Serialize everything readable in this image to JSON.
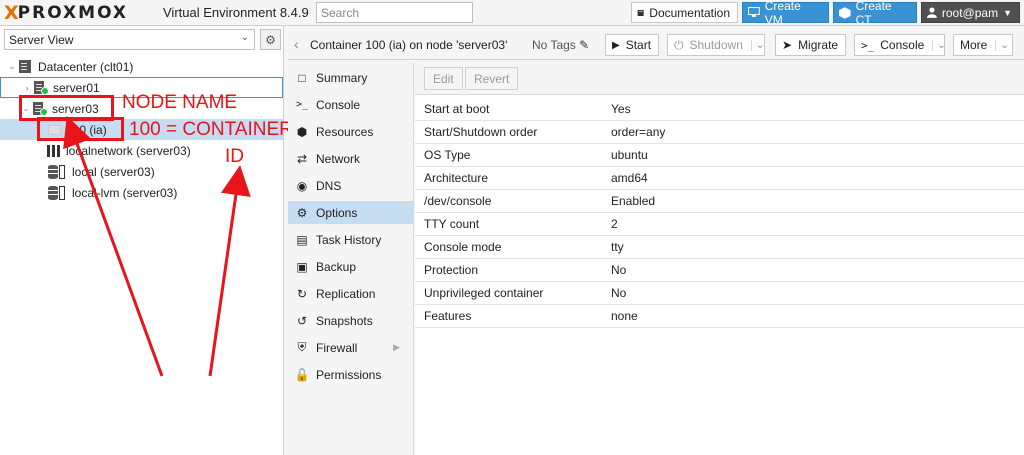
{
  "topbar": {
    "logo_x": "X",
    "logo_brand": "PROXMOX",
    "title": "Virtual Environment 8.4.9",
    "search_placeholder": "Search",
    "documentation": "Documentation",
    "create_vm": "Create VM",
    "create_ct": "Create CT",
    "user": "root@pam"
  },
  "tree": {
    "view": "Server View",
    "items": [
      {
        "label": "Datacenter (clt01)"
      },
      {
        "label": "server01"
      },
      {
        "label": "server03"
      },
      {
        "label": "100 (ia)"
      },
      {
        "label": "localnetwork (server03)"
      },
      {
        "label": "local (server03)"
      },
      {
        "label": "local-lvm (server03)"
      }
    ]
  },
  "annotations": {
    "node_name": "NODE NAME",
    "container_line1": "100 = CONTAINER",
    "container_line2": "ID",
    "color": "#e8141b"
  },
  "header": {
    "title": "Container 100 (ia) on node 'server03'",
    "no_tags": "No Tags",
    "start": "Start",
    "shutdown": "Shutdown",
    "migrate": "Migrate",
    "console": "Console",
    "more": "More"
  },
  "menu": {
    "items": [
      {
        "label": "Summary",
        "icon": "book-icon"
      },
      {
        "label": "Console",
        "icon": "terminal-icon"
      },
      {
        "label": "Resources",
        "icon": "cube-icon"
      },
      {
        "label": "Network",
        "icon": "exchange-icon"
      },
      {
        "label": "DNS",
        "icon": "globe-icon"
      },
      {
        "label": "Options",
        "icon": "gear-icon"
      },
      {
        "label": "Task History",
        "icon": "list-icon"
      },
      {
        "label": "Backup",
        "icon": "floppy-icon"
      },
      {
        "label": "Replication",
        "icon": "retweet-icon"
      },
      {
        "label": "Snapshots",
        "icon": "history-icon"
      },
      {
        "label": "Firewall",
        "icon": "shield-icon"
      },
      {
        "label": "Permissions",
        "icon": "unlock-icon"
      }
    ],
    "active": "Options"
  },
  "options": {
    "edit": "Edit",
    "revert": "Revert",
    "rows": [
      {
        "key": "Start at boot",
        "value": "Yes"
      },
      {
        "key": "Start/Shutdown order",
        "value": "order=any"
      },
      {
        "key": "OS Type",
        "value": "ubuntu"
      },
      {
        "key": "Architecture",
        "value": "amd64"
      },
      {
        "key": "/dev/console",
        "value": "Enabled"
      },
      {
        "key": "TTY count",
        "value": "2"
      },
      {
        "key": "Console mode",
        "value": "tty"
      },
      {
        "key": "Protection",
        "value": "No"
      },
      {
        "key": "Unprivileged container",
        "value": "No"
      },
      {
        "key": "Features",
        "value": "none"
      }
    ]
  },
  "colors": {
    "accent": "#3892d4",
    "selection": "#c6dcf1",
    "status_ok": "#21bf4b",
    "brand_orange": "#e57000"
  }
}
